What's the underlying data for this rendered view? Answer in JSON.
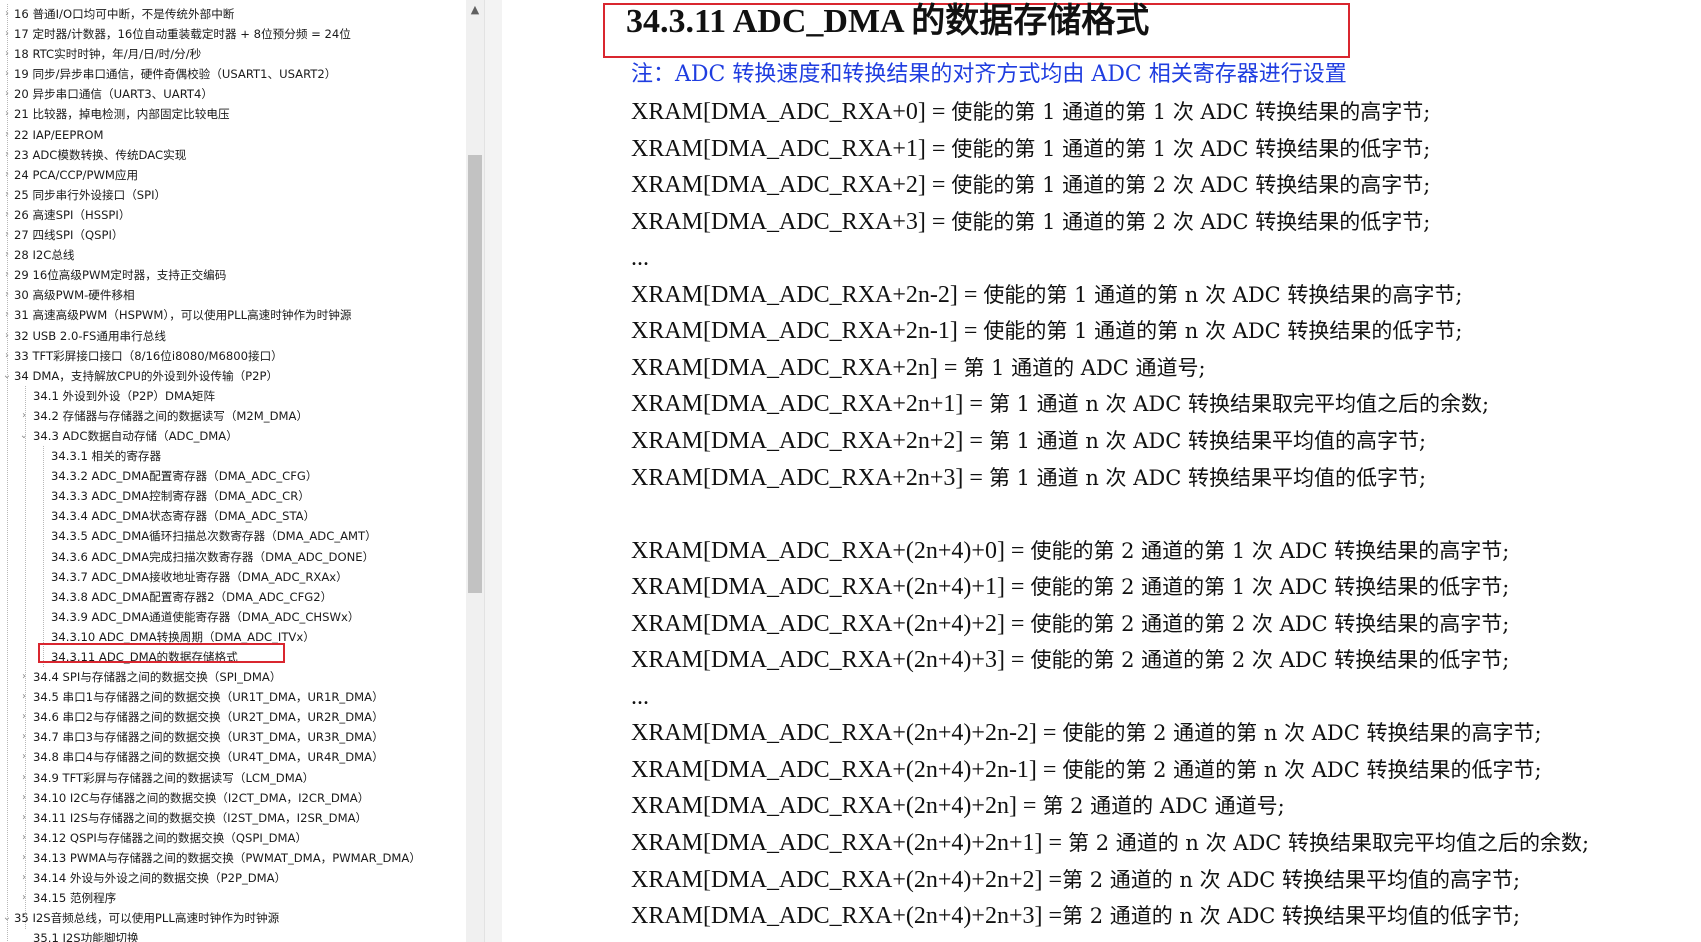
{
  "sidebar": {
    "items": [
      {
        "label": "16 普通I/O口均可中断，不是传统外部中断",
        "level": 0,
        "expander": "closed"
      },
      {
        "label": "17 定时器/计数器，16位自动重装载定时器 + 8位预分频 = 24位",
        "level": 0,
        "expander": "closed"
      },
      {
        "label": "18 RTC实时时钟，年/月/日/时/分/秒",
        "level": 0,
        "expander": "closed"
      },
      {
        "label": "19 同步/异步串口通信，硬件奇偶校验（USART1、USART2）",
        "level": 0,
        "expander": "closed"
      },
      {
        "label": "20 异步串口通信（UART3、UART4）",
        "level": 0,
        "expander": "closed"
      },
      {
        "label": "21 比较器，掉电检测，内部固定比较电压",
        "level": 0,
        "expander": "closed"
      },
      {
        "label": "22 IAP/EEPROM",
        "level": 0,
        "expander": "closed"
      },
      {
        "label": "23 ADC模数转换、传统DAC实现",
        "level": 0,
        "expander": "closed"
      },
      {
        "label": "24 PCA/CCP/PWM应用",
        "level": 0,
        "expander": "closed"
      },
      {
        "label": "25 同步串行外设接口（SPI）",
        "level": 0,
        "expander": "closed"
      },
      {
        "label": "26 高速SPI（HSSPI）",
        "level": 0,
        "expander": "closed"
      },
      {
        "label": "27 四线SPI（QSPI）",
        "level": 0,
        "expander": "closed"
      },
      {
        "label": "28 I2C总线",
        "level": 0,
        "expander": "closed"
      },
      {
        "label": "29 16位高级PWM定时器，支持正交编码",
        "level": 0,
        "expander": "closed"
      },
      {
        "label": "30 高级PWM-硬件移相",
        "level": 0,
        "expander": "closed"
      },
      {
        "label": "31 高速高级PWM（HSPWM），可以使用PLL高速时钟作为时钟源",
        "level": 0,
        "expander": "closed"
      },
      {
        "label": "32 USB 2.0-FS通用串行总线",
        "level": 0,
        "expander": "closed"
      },
      {
        "label": "33 TFT彩屏接口接口（8/16位i8080/M6800接口）",
        "level": 0,
        "expander": "closed"
      },
      {
        "label": "34 DMA，支持解放CPU的外设到外设传输（P2P）",
        "level": 0,
        "expander": "open"
      },
      {
        "label": "34.1 外设到外设（P2P）DMA矩阵",
        "level": 1,
        "expander": "none"
      },
      {
        "label": "34.2 存储器与存储器之间的数据读写（M2M_DMA）",
        "level": 1,
        "expander": "closed"
      },
      {
        "label": "34.3 ADC数据自动存储（ADC_DMA）",
        "level": 1,
        "expander": "open"
      },
      {
        "label": "34.3.1 相关的寄存器",
        "level": 2,
        "expander": "none"
      },
      {
        "label": "34.3.2 ADC_DMA配置寄存器（DMA_ADC_CFG）",
        "level": 2,
        "expander": "none"
      },
      {
        "label": "34.3.3 ADC_DMA控制寄存器（DMA_ADC_CR）",
        "level": 2,
        "expander": "none"
      },
      {
        "label": "34.3.4 ADC_DMA状态寄存器（DMA_ADC_STA）",
        "level": 2,
        "expander": "none"
      },
      {
        "label": "34.3.5 ADC_DMA循环扫描总次数寄存器（DMA_ADC_AMT）",
        "level": 2,
        "expander": "none"
      },
      {
        "label": "34.3.6 ADC_DMA完成扫描次数寄存器（DMA_ADC_DONE）",
        "level": 2,
        "expander": "none"
      },
      {
        "label": "34.3.7 ADC_DMA接收地址寄存器（DMA_ADC_RXAx）",
        "level": 2,
        "expander": "none"
      },
      {
        "label": "34.3.8 ADC_DMA配置寄存器2（DMA_ADC_CFG2）",
        "level": 2,
        "expander": "none"
      },
      {
        "label": "34.3.9 ADC_DMA通道使能寄存器（DMA_ADC_CHSWx）",
        "level": 2,
        "expander": "none"
      },
      {
        "label": "34.3.10 ADC_DMA转换周期（DMA_ADC_ITVx）",
        "level": 2,
        "expander": "none"
      },
      {
        "label": "34.3.11 ADC_DMA的数据存储格式",
        "level": 2,
        "expander": "none",
        "selected": true
      },
      {
        "label": "34.4 SPI与存储器之间的数据交换（SPI_DMA）",
        "level": 1,
        "expander": "closed"
      },
      {
        "label": "34.5 串口1与存储器之间的数据交换（UR1T_DMA，UR1R_DMA）",
        "level": 1,
        "expander": "closed"
      },
      {
        "label": "34.6 串口2与存储器之间的数据交换（UR2T_DMA，UR2R_DMA）",
        "level": 1,
        "expander": "closed"
      },
      {
        "label": "34.7 串口3与存储器之间的数据交换（UR3T_DMA，UR3R_DMA）",
        "level": 1,
        "expander": "closed"
      },
      {
        "label": "34.8 串口4与存储器之间的数据交换（UR4T_DMA，UR4R_DMA）",
        "level": 1,
        "expander": "closed"
      },
      {
        "label": "34.9 TFT彩屏与存储器之间的数据读写（LCM_DMA）",
        "level": 1,
        "expander": "closed"
      },
      {
        "label": "34.10 I2C与存储器之间的数据交换（I2CT_DMA，I2CR_DMA）",
        "level": 1,
        "expander": "closed"
      },
      {
        "label": "34.11 I2S与存储器之间的数据交换（I2ST_DMA，I2SR_DMA）",
        "level": 1,
        "expander": "closed"
      },
      {
        "label": "34.12 QSPI与存储器之间的数据交换（QSPI_DMA）",
        "level": 1,
        "expander": "closed"
      },
      {
        "label": "34.13 PWMA与存储器之间的数据交换（PWMAT_DMA，PWMAR_DMA）",
        "level": 1,
        "expander": "closed"
      },
      {
        "label": "34.14 外设与外设之间的数据交换（P2P_DMA）",
        "level": 1,
        "expander": "closed"
      },
      {
        "label": "34.15 范例程序",
        "level": 1,
        "expander": "closed"
      },
      {
        "label": "35 I2S音频总线，可以使用PLL高速时钟作为时钟源",
        "level": 0,
        "expander": "open"
      },
      {
        "label": "35.1 I2S功能脚切换",
        "level": 1,
        "expander": "none"
      }
    ]
  },
  "document": {
    "heading": "34.3.11    ADC_DMA 的数据存储格式",
    "note": "注：ADC 转换速度和转换结果的对齐方式均由 ADC 相关寄存器进行设置",
    "lines": [
      {
        "reg": "XRAM[DMA_ADC_RXA+0] = ",
        "desc": "使能的第 1 通道的第 1 次 ADC 转换结果的高字节;"
      },
      {
        "reg": "XRAM[DMA_ADC_RXA+1] = ",
        "desc": "使能的第 1 通道的第 1 次 ADC 转换结果的低字节;"
      },
      {
        "reg": "XRAM[DMA_ADC_RXA+2] = ",
        "desc": "使能的第 1 通道的第 2 次 ADC 转换结果的高字节;"
      },
      {
        "reg": "XRAM[DMA_ADC_RXA+3] = ",
        "desc": "使能的第 1 通道的第 2 次 ADC 转换结果的低字节;"
      },
      {
        "reg": "...",
        "desc": ""
      },
      {
        "reg": "XRAM[DMA_ADC_RXA+2n-2] = ",
        "desc": "使能的第 1 通道的第 n 次 ADC 转换结果的高字节;"
      },
      {
        "reg": "XRAM[DMA_ADC_RXA+2n-1] = ",
        "desc": "使能的第 1 通道的第 n 次 ADC 转换结果的低字节;"
      },
      {
        "reg": "XRAM[DMA_ADC_RXA+2n] = ",
        "desc": "第 1 通道的 ADC 通道号;"
      },
      {
        "reg": "XRAM[DMA_ADC_RXA+2n+1] = ",
        "desc": "第 1 通道 n 次 ADC 转换结果取完平均值之后的余数;"
      },
      {
        "reg": "XRAM[DMA_ADC_RXA+2n+2] = ",
        "desc": "第 1 通道 n 次 ADC 转换结果平均值的高字节;"
      },
      {
        "reg": "XRAM[DMA_ADC_RXA+2n+3] = ",
        "desc": "第 1 通道 n 次 ADC 转换结果平均值的低字节;"
      },
      {
        "reg": "",
        "desc": ""
      },
      {
        "reg": "XRAM[DMA_ADC_RXA+(2n+4)+0] = ",
        "desc": "使能的第 2 通道的第 1 次 ADC 转换结果的高字节;"
      },
      {
        "reg": "XRAM[DMA_ADC_RXA+(2n+4)+1] = ",
        "desc": "使能的第 2 通道的第 1 次 ADC 转换结果的低字节;"
      },
      {
        "reg": "XRAM[DMA_ADC_RXA+(2n+4)+2] = ",
        "desc": "使能的第 2 通道的第 2 次 ADC 转换结果的高字节;"
      },
      {
        "reg": "XRAM[DMA_ADC_RXA+(2n+4)+3] = ",
        "desc": "使能的第 2 通道的第 2 次 ADC 转换结果的低字节;"
      },
      {
        "reg": "...",
        "desc": ""
      },
      {
        "reg": "XRAM[DMA_ADC_RXA+(2n+4)+2n-2] = ",
        "desc": "使能的第 2 通道的第 n 次 ADC 转换结果的高字节;"
      },
      {
        "reg": "XRAM[DMA_ADC_RXA+(2n+4)+2n-1] = ",
        "desc": "使能的第 2 通道的第 n 次 ADC 转换结果的低字节;"
      },
      {
        "reg": "XRAM[DMA_ADC_RXA+(2n+4)+2n] = ",
        "desc": "第 2 通道的 ADC 通道号;"
      },
      {
        "reg": "XRAM[DMA_ADC_RXA+(2n+4)+2n+1] = ",
        "desc": "第 2 通道的 n 次 ADC 转换结果取完平均值之后的余数;"
      },
      {
        "reg": "XRAM[DMA_ADC_RXA+(2n+4)+2n+2] =",
        "desc": "第 2 通道的 n 次 ADC 转换结果平均值的高字节;"
      },
      {
        "reg": "XRAM[DMA_ADC_RXA+(2n+4)+2n+3] =",
        "desc": "第 2 通道的 n 次 ADC 转换结果平均值的低字节;"
      }
    ]
  },
  "icons": {
    "collapsed": "chevron-right-icon",
    "expanded": "chevron-down-icon",
    "scroll_up": "chevron-up-icon"
  },
  "colors": {
    "highlight_border": "#d9262f",
    "note_text": "#1f3de0",
    "body_text": "#111111"
  }
}
